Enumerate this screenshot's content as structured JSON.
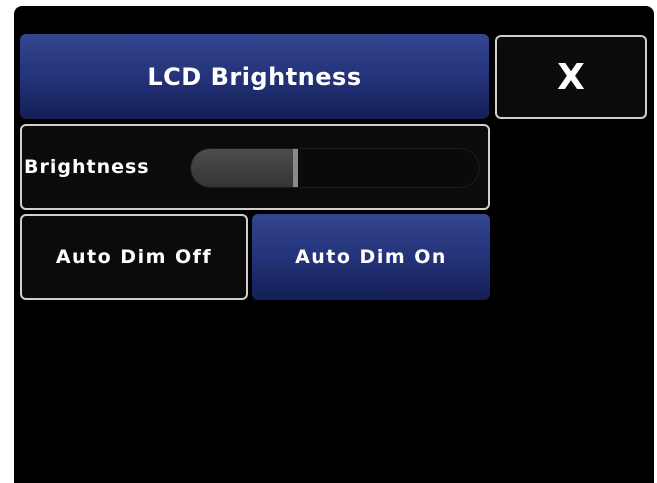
{
  "header": {
    "title": "LCD Brightness",
    "close_label": "X"
  },
  "brightness": {
    "label": "Brightness",
    "level_fraction": 0.37
  },
  "auto_dim": {
    "off_label": "Auto Dim Off",
    "on_label": "Auto Dim On",
    "selected": "on"
  },
  "colors": {
    "background": "#000000",
    "accent": "#24337a",
    "border": "#cfcfcf",
    "text": "#ffffff"
  }
}
